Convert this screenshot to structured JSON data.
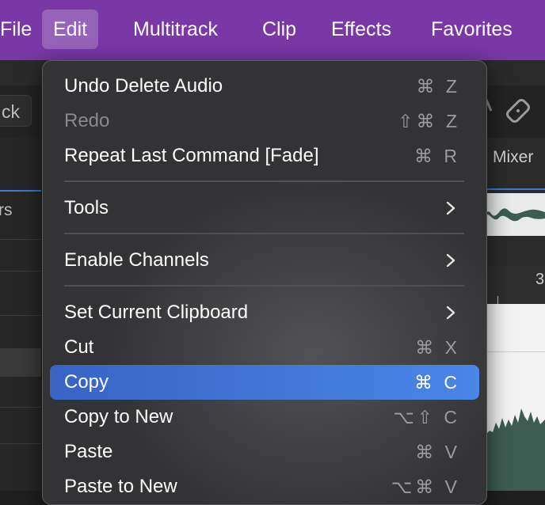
{
  "menubar": {
    "items": [
      {
        "label": "File"
      },
      {
        "label": "Edit"
      },
      {
        "label": "Multitrack"
      },
      {
        "label": "Clip"
      },
      {
        "label": "Effects"
      },
      {
        "label": "Favorites"
      }
    ]
  },
  "background": {
    "track_button": "ck",
    "left_text": "rs",
    "mixer_tab": "Mixer",
    "ruler_number": "3"
  },
  "edit_menu": {
    "items": [
      {
        "label": "Undo Delete Audio",
        "shortcut": "⌘ Z"
      },
      {
        "label": "Redo",
        "shortcut": "⇧⌘ Z"
      },
      {
        "label": "Repeat Last Command [Fade]",
        "shortcut": "⌘ R"
      },
      {
        "label": "Tools"
      },
      {
        "label": "Enable Channels"
      },
      {
        "label": "Set Current Clipboard"
      },
      {
        "label": "Cut",
        "shortcut": "⌘ X"
      },
      {
        "label": "Copy",
        "shortcut": "⌘ C"
      },
      {
        "label": "Copy to New",
        "shortcut": "⌥⇧ C"
      },
      {
        "label": "Paste",
        "shortcut": "⌘ V"
      },
      {
        "label": "Paste to New",
        "shortcut": "⌥⌘ V"
      }
    ]
  }
}
